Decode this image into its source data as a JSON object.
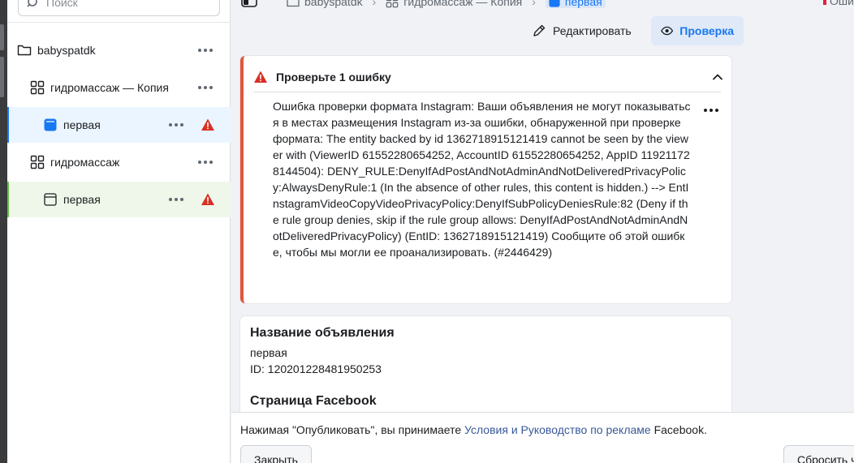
{
  "sidebar": {
    "search_placeholder": "Поиск",
    "items": [
      {
        "label": "babyspatdk"
      },
      {
        "label": "гидромассаж — Копия"
      },
      {
        "label": "первая"
      },
      {
        "label": "гидромассаж"
      },
      {
        "label": "первая"
      }
    ]
  },
  "topbar": {
    "breadcrumbs": [
      "babyspatdk",
      "гидромассаж — Копия",
      "первая"
    ],
    "errors_label": "Оши",
    "edit_label": "Редактировать",
    "review_label": "Проверка"
  },
  "error_card": {
    "title": "Проверьте 1 ошибку",
    "message": "Ошибка проверки формата Instagram: Ваши объявления не могут показываться в местах размещения Instagram из-за ошибки, обнаруженной при проверке формата: The entity backed by id 1362718915121419 cannot be seen by the viewer with (ViewerID 61552280654252, AccountID 61552280654252, AppID 119211728144504): DENY_RULE:DenyIfAdPostAndNotAdminAndNotDeliveredPrivacyPolicy:AlwaysDenyRule:1 (In the absence of other rules, this content is hidden.) --> EntInstagramVideoCopyVideoPrivacyPolicy:DenyIfSubPolicyDeniesRule:82 (Deny if the rule group denies, skip if the rule group allows: DenyIfAdPostAndNotAdminAndNotDeliveredPrivacyPolicy) (EntID: 1362718915121419) Сообщите об этой ошибке, чтобы мы могли ее проанализировать. (#2446429)"
  },
  "ad_info": {
    "name_heading": "Название объявления",
    "name_value": "первая",
    "id_text": "ID: 120201228481950253",
    "page_heading": "Страница Facebook"
  },
  "footer": {
    "terms_prefix": "Нажимая \"Опубликовать\", вы принимаете ",
    "terms_link": "Условия и Руководство по рекламе",
    "terms_suffix": " Facebook.",
    "close_label": "Закрыть",
    "reset_label": "Сбросить ч"
  },
  "colors": {
    "accent": "#1877f2",
    "error": "#e2553a",
    "warning_icon": "#d93025"
  }
}
